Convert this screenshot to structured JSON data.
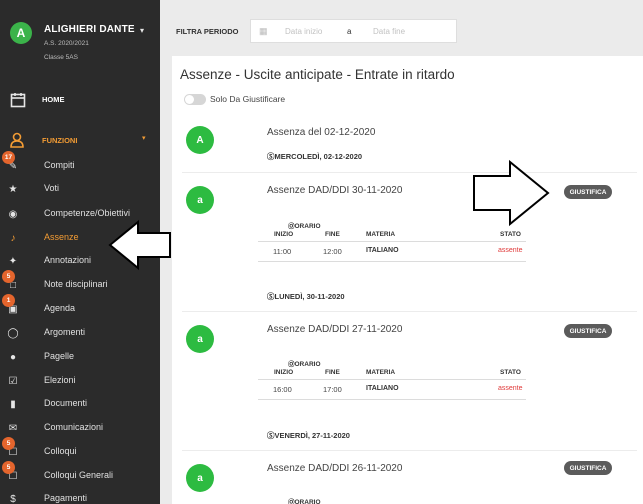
{
  "user": {
    "avatar_letter": "A",
    "name": "ALIGHIERI DANTE",
    "school_year": "A.S. 2020/2021",
    "class": "Classe 5AS"
  },
  "nav": {
    "home": "HOME",
    "funzioni": "FUNZIONI",
    "items": [
      {
        "label": "Compiti",
        "icon": "pencil-icon",
        "badge": "17"
      },
      {
        "label": "Voti",
        "icon": "trophy-icon",
        "badge": ""
      },
      {
        "label": "Competenze/Obiettivi",
        "icon": "target-icon",
        "badge": ""
      },
      {
        "label": "Assenze",
        "icon": "bell-icon",
        "badge": ""
      },
      {
        "label": "Annotazioni",
        "icon": "pin-icon",
        "badge": ""
      },
      {
        "label": "Note disciplinari",
        "icon": "note-icon",
        "badge": "5"
      },
      {
        "label": "Agenda",
        "icon": "calendar-icon",
        "badge": "1"
      },
      {
        "label": "Argomenti",
        "icon": "bulb-icon",
        "badge": ""
      },
      {
        "label": "Pagelle",
        "icon": "medal-icon",
        "badge": ""
      },
      {
        "label": "Elezioni",
        "icon": "vote-icon",
        "badge": ""
      },
      {
        "label": "Documenti",
        "icon": "document-icon",
        "badge": ""
      },
      {
        "label": "Comunicazioni",
        "icon": "mail-icon",
        "badge": ""
      },
      {
        "label": "Colloqui",
        "icon": "chat-icon",
        "badge": "5"
      },
      {
        "label": "Colloqui Generali",
        "icon": "chat-group-icon",
        "badge": "5"
      },
      {
        "label": "Pagamenti",
        "icon": "dollar-icon",
        "badge": ""
      }
    ]
  },
  "filter": {
    "label": "FILTRA PERIODO",
    "from_placeholder": "Data inizio",
    "separator": "a",
    "to_placeholder": "Data fine"
  },
  "main": {
    "title": "Assenze - Uscite anticipate - Entrate in ritardo",
    "toggle_label": "Solo Da Giustificare",
    "entries": [
      {
        "circle": "A",
        "title": "Assenza del 02-12-2020",
        "date": "ⓈMERCOLEDÌ, 02-12-2020",
        "giustifica": ""
      },
      {
        "circle": "a",
        "title": "Assenze DAD/DDI 30-11-2020",
        "giustifica": "GIUSTIFICA",
        "orario": "ⓄORARIO",
        "headers": {
          "inizio": "INIZIO",
          "fine": "FINE",
          "materia": "MATERIA",
          "stato": "STATO"
        },
        "row": {
          "inizio": "11:00",
          "fine": "12:00",
          "materia": "ITALIANO",
          "stato": "assente"
        },
        "date": "ⓈLUNEDÌ, 30-11-2020"
      },
      {
        "circle": "a",
        "title": "Assenze DAD/DDI 27-11-2020",
        "giustifica": "GIUSTIFICA",
        "orario": "ⓄORARIO",
        "headers": {
          "inizio": "INIZIO",
          "fine": "FINE",
          "materia": "MATERIA",
          "stato": "STATO"
        },
        "row": {
          "inizio": "16:00",
          "fine": "17:00",
          "materia": "ITALIANO",
          "stato": "assente"
        },
        "date": "ⓈVENERDÌ, 27-11-2020"
      },
      {
        "circle": "a",
        "title": "Assenze DAD/DDI 26-11-2020",
        "giustifica": "GIUSTIFICA",
        "orario": "ⓄORARIO"
      }
    ]
  },
  "colors": {
    "sidebar_bg": "#2b2b2b",
    "accent": "#f39c34",
    "green": "#2dbb41",
    "badge": "#e4652d",
    "absent": "#e03a3a"
  }
}
